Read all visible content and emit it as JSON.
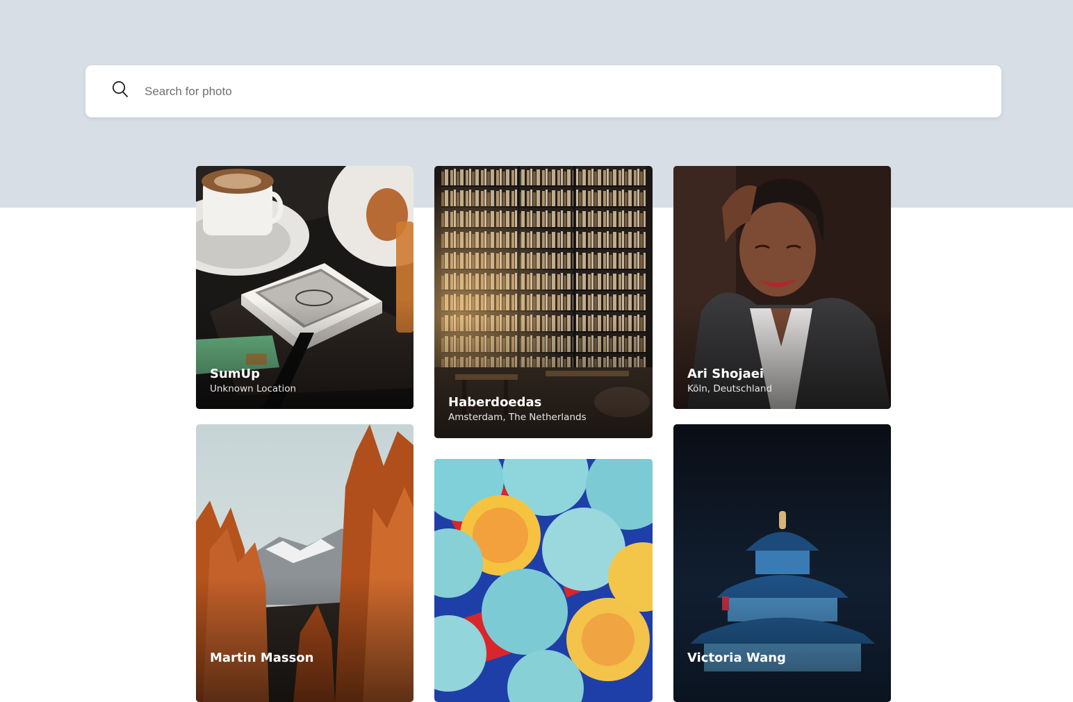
{
  "search": {
    "placeholder": "Search for photo",
    "value": ""
  },
  "photos": [
    {
      "name": "SumUp",
      "location": "Unknown Location",
      "subject": "card payment terminal on cafe table"
    },
    {
      "name": "Haberdoedas",
      "location": "Amsterdam, The Netherlands",
      "subject": "tall bookshelf wall in cafe"
    },
    {
      "name": "Ari Shojaei",
      "location": "Köln, Deutschland",
      "subject": "smiling woman portrait"
    },
    {
      "name": "Martin Masson",
      "location": "",
      "subject": "orange autumn larch trees and mountains"
    },
    {
      "name": "",
      "location": "",
      "subject": "abstract colorful overlapping discs"
    },
    {
      "name": "Victoria Wang",
      "location": "",
      "subject": "Temple of Heaven at night"
    }
  ],
  "colors": {
    "hero_background": "#d8dee6",
    "page_background": "#ffffff",
    "search_background": "#ffffff",
    "caption_text": "#ffffff"
  }
}
